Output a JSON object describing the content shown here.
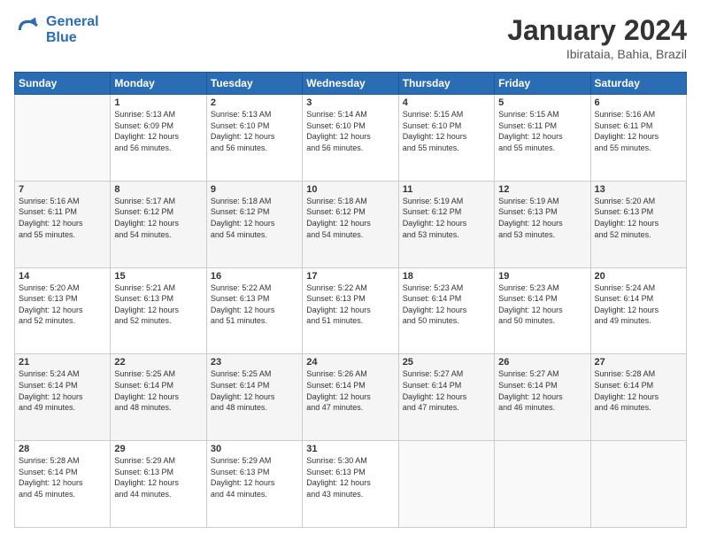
{
  "logo": {
    "line1": "General",
    "line2": "Blue"
  },
  "title": "January 2024",
  "subtitle": "Ibirataia, Bahia, Brazil",
  "weekdays": [
    "Sunday",
    "Monday",
    "Tuesday",
    "Wednesday",
    "Thursday",
    "Friday",
    "Saturday"
  ],
  "weeks": [
    [
      {
        "day": null,
        "info": null
      },
      {
        "day": "1",
        "info": "Sunrise: 5:13 AM\nSunset: 6:09 PM\nDaylight: 12 hours\nand 56 minutes."
      },
      {
        "day": "2",
        "info": "Sunrise: 5:13 AM\nSunset: 6:10 PM\nDaylight: 12 hours\nand 56 minutes."
      },
      {
        "day": "3",
        "info": "Sunrise: 5:14 AM\nSunset: 6:10 PM\nDaylight: 12 hours\nand 56 minutes."
      },
      {
        "day": "4",
        "info": "Sunrise: 5:15 AM\nSunset: 6:10 PM\nDaylight: 12 hours\nand 55 minutes."
      },
      {
        "day": "5",
        "info": "Sunrise: 5:15 AM\nSunset: 6:11 PM\nDaylight: 12 hours\nand 55 minutes."
      },
      {
        "day": "6",
        "info": "Sunrise: 5:16 AM\nSunset: 6:11 PM\nDaylight: 12 hours\nand 55 minutes."
      }
    ],
    [
      {
        "day": "7",
        "info": "Sunrise: 5:16 AM\nSunset: 6:11 PM\nDaylight: 12 hours\nand 55 minutes."
      },
      {
        "day": "8",
        "info": "Sunrise: 5:17 AM\nSunset: 6:12 PM\nDaylight: 12 hours\nand 54 minutes."
      },
      {
        "day": "9",
        "info": "Sunrise: 5:18 AM\nSunset: 6:12 PM\nDaylight: 12 hours\nand 54 minutes."
      },
      {
        "day": "10",
        "info": "Sunrise: 5:18 AM\nSunset: 6:12 PM\nDaylight: 12 hours\nand 54 minutes."
      },
      {
        "day": "11",
        "info": "Sunrise: 5:19 AM\nSunset: 6:12 PM\nDaylight: 12 hours\nand 53 minutes."
      },
      {
        "day": "12",
        "info": "Sunrise: 5:19 AM\nSunset: 6:13 PM\nDaylight: 12 hours\nand 53 minutes."
      },
      {
        "day": "13",
        "info": "Sunrise: 5:20 AM\nSunset: 6:13 PM\nDaylight: 12 hours\nand 52 minutes."
      }
    ],
    [
      {
        "day": "14",
        "info": "Sunrise: 5:20 AM\nSunset: 6:13 PM\nDaylight: 12 hours\nand 52 minutes."
      },
      {
        "day": "15",
        "info": "Sunrise: 5:21 AM\nSunset: 6:13 PM\nDaylight: 12 hours\nand 52 minutes."
      },
      {
        "day": "16",
        "info": "Sunrise: 5:22 AM\nSunset: 6:13 PM\nDaylight: 12 hours\nand 51 minutes."
      },
      {
        "day": "17",
        "info": "Sunrise: 5:22 AM\nSunset: 6:13 PM\nDaylight: 12 hours\nand 51 minutes."
      },
      {
        "day": "18",
        "info": "Sunrise: 5:23 AM\nSunset: 6:14 PM\nDaylight: 12 hours\nand 50 minutes."
      },
      {
        "day": "19",
        "info": "Sunrise: 5:23 AM\nSunset: 6:14 PM\nDaylight: 12 hours\nand 50 minutes."
      },
      {
        "day": "20",
        "info": "Sunrise: 5:24 AM\nSunset: 6:14 PM\nDaylight: 12 hours\nand 49 minutes."
      }
    ],
    [
      {
        "day": "21",
        "info": "Sunrise: 5:24 AM\nSunset: 6:14 PM\nDaylight: 12 hours\nand 49 minutes."
      },
      {
        "day": "22",
        "info": "Sunrise: 5:25 AM\nSunset: 6:14 PM\nDaylight: 12 hours\nand 48 minutes."
      },
      {
        "day": "23",
        "info": "Sunrise: 5:25 AM\nSunset: 6:14 PM\nDaylight: 12 hours\nand 48 minutes."
      },
      {
        "day": "24",
        "info": "Sunrise: 5:26 AM\nSunset: 6:14 PM\nDaylight: 12 hours\nand 47 minutes."
      },
      {
        "day": "25",
        "info": "Sunrise: 5:27 AM\nSunset: 6:14 PM\nDaylight: 12 hours\nand 47 minutes."
      },
      {
        "day": "26",
        "info": "Sunrise: 5:27 AM\nSunset: 6:14 PM\nDaylight: 12 hours\nand 46 minutes."
      },
      {
        "day": "27",
        "info": "Sunrise: 5:28 AM\nSunset: 6:14 PM\nDaylight: 12 hours\nand 46 minutes."
      }
    ],
    [
      {
        "day": "28",
        "info": "Sunrise: 5:28 AM\nSunset: 6:14 PM\nDaylight: 12 hours\nand 45 minutes."
      },
      {
        "day": "29",
        "info": "Sunrise: 5:29 AM\nSunset: 6:13 PM\nDaylight: 12 hours\nand 44 minutes."
      },
      {
        "day": "30",
        "info": "Sunrise: 5:29 AM\nSunset: 6:13 PM\nDaylight: 12 hours\nand 44 minutes."
      },
      {
        "day": "31",
        "info": "Sunrise: 5:30 AM\nSunset: 6:13 PM\nDaylight: 12 hours\nand 43 minutes."
      },
      {
        "day": null,
        "info": null
      },
      {
        "day": null,
        "info": null
      },
      {
        "day": null,
        "info": null
      }
    ]
  ]
}
